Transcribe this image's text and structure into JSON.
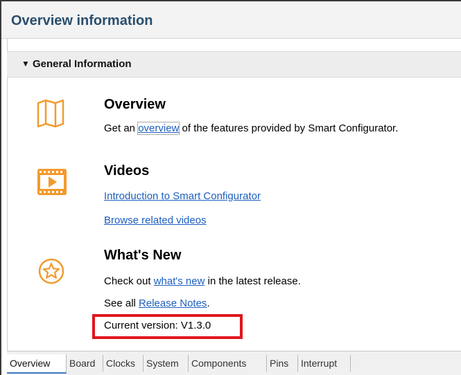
{
  "header": {
    "title": "Overview information"
  },
  "section": {
    "label": "General Information"
  },
  "overview": {
    "title": "Overview",
    "desc_prefix": "Get an ",
    "desc_link": "overview",
    "desc_suffix": " of the features provided by Smart Configurator."
  },
  "videos": {
    "title": "Videos",
    "link1": "Introduction to Smart Configurator",
    "link2": "Browse related videos"
  },
  "whatsnew": {
    "title": "What's New",
    "line1_prefix": "Check out ",
    "line1_link": "what's new",
    "line1_suffix": " in the latest release.",
    "line2_prefix": "See all ",
    "line2_link": "Release Notes",
    "line2_suffix": ".",
    "version": "Current version: V1.3.0"
  },
  "tabs": [
    "Overview",
    "Board",
    "Clocks",
    "System",
    "Components",
    "Pins",
    "Interrupt"
  ],
  "colors": {
    "accent_orange": "#f29a2e",
    "link": "#1c5fbf",
    "highlight": "#e0161d",
    "title": "#2a4e6e"
  },
  "icons": {
    "overview": "map-icon",
    "videos": "video-play-icon",
    "whatsnew": "star-icon"
  }
}
